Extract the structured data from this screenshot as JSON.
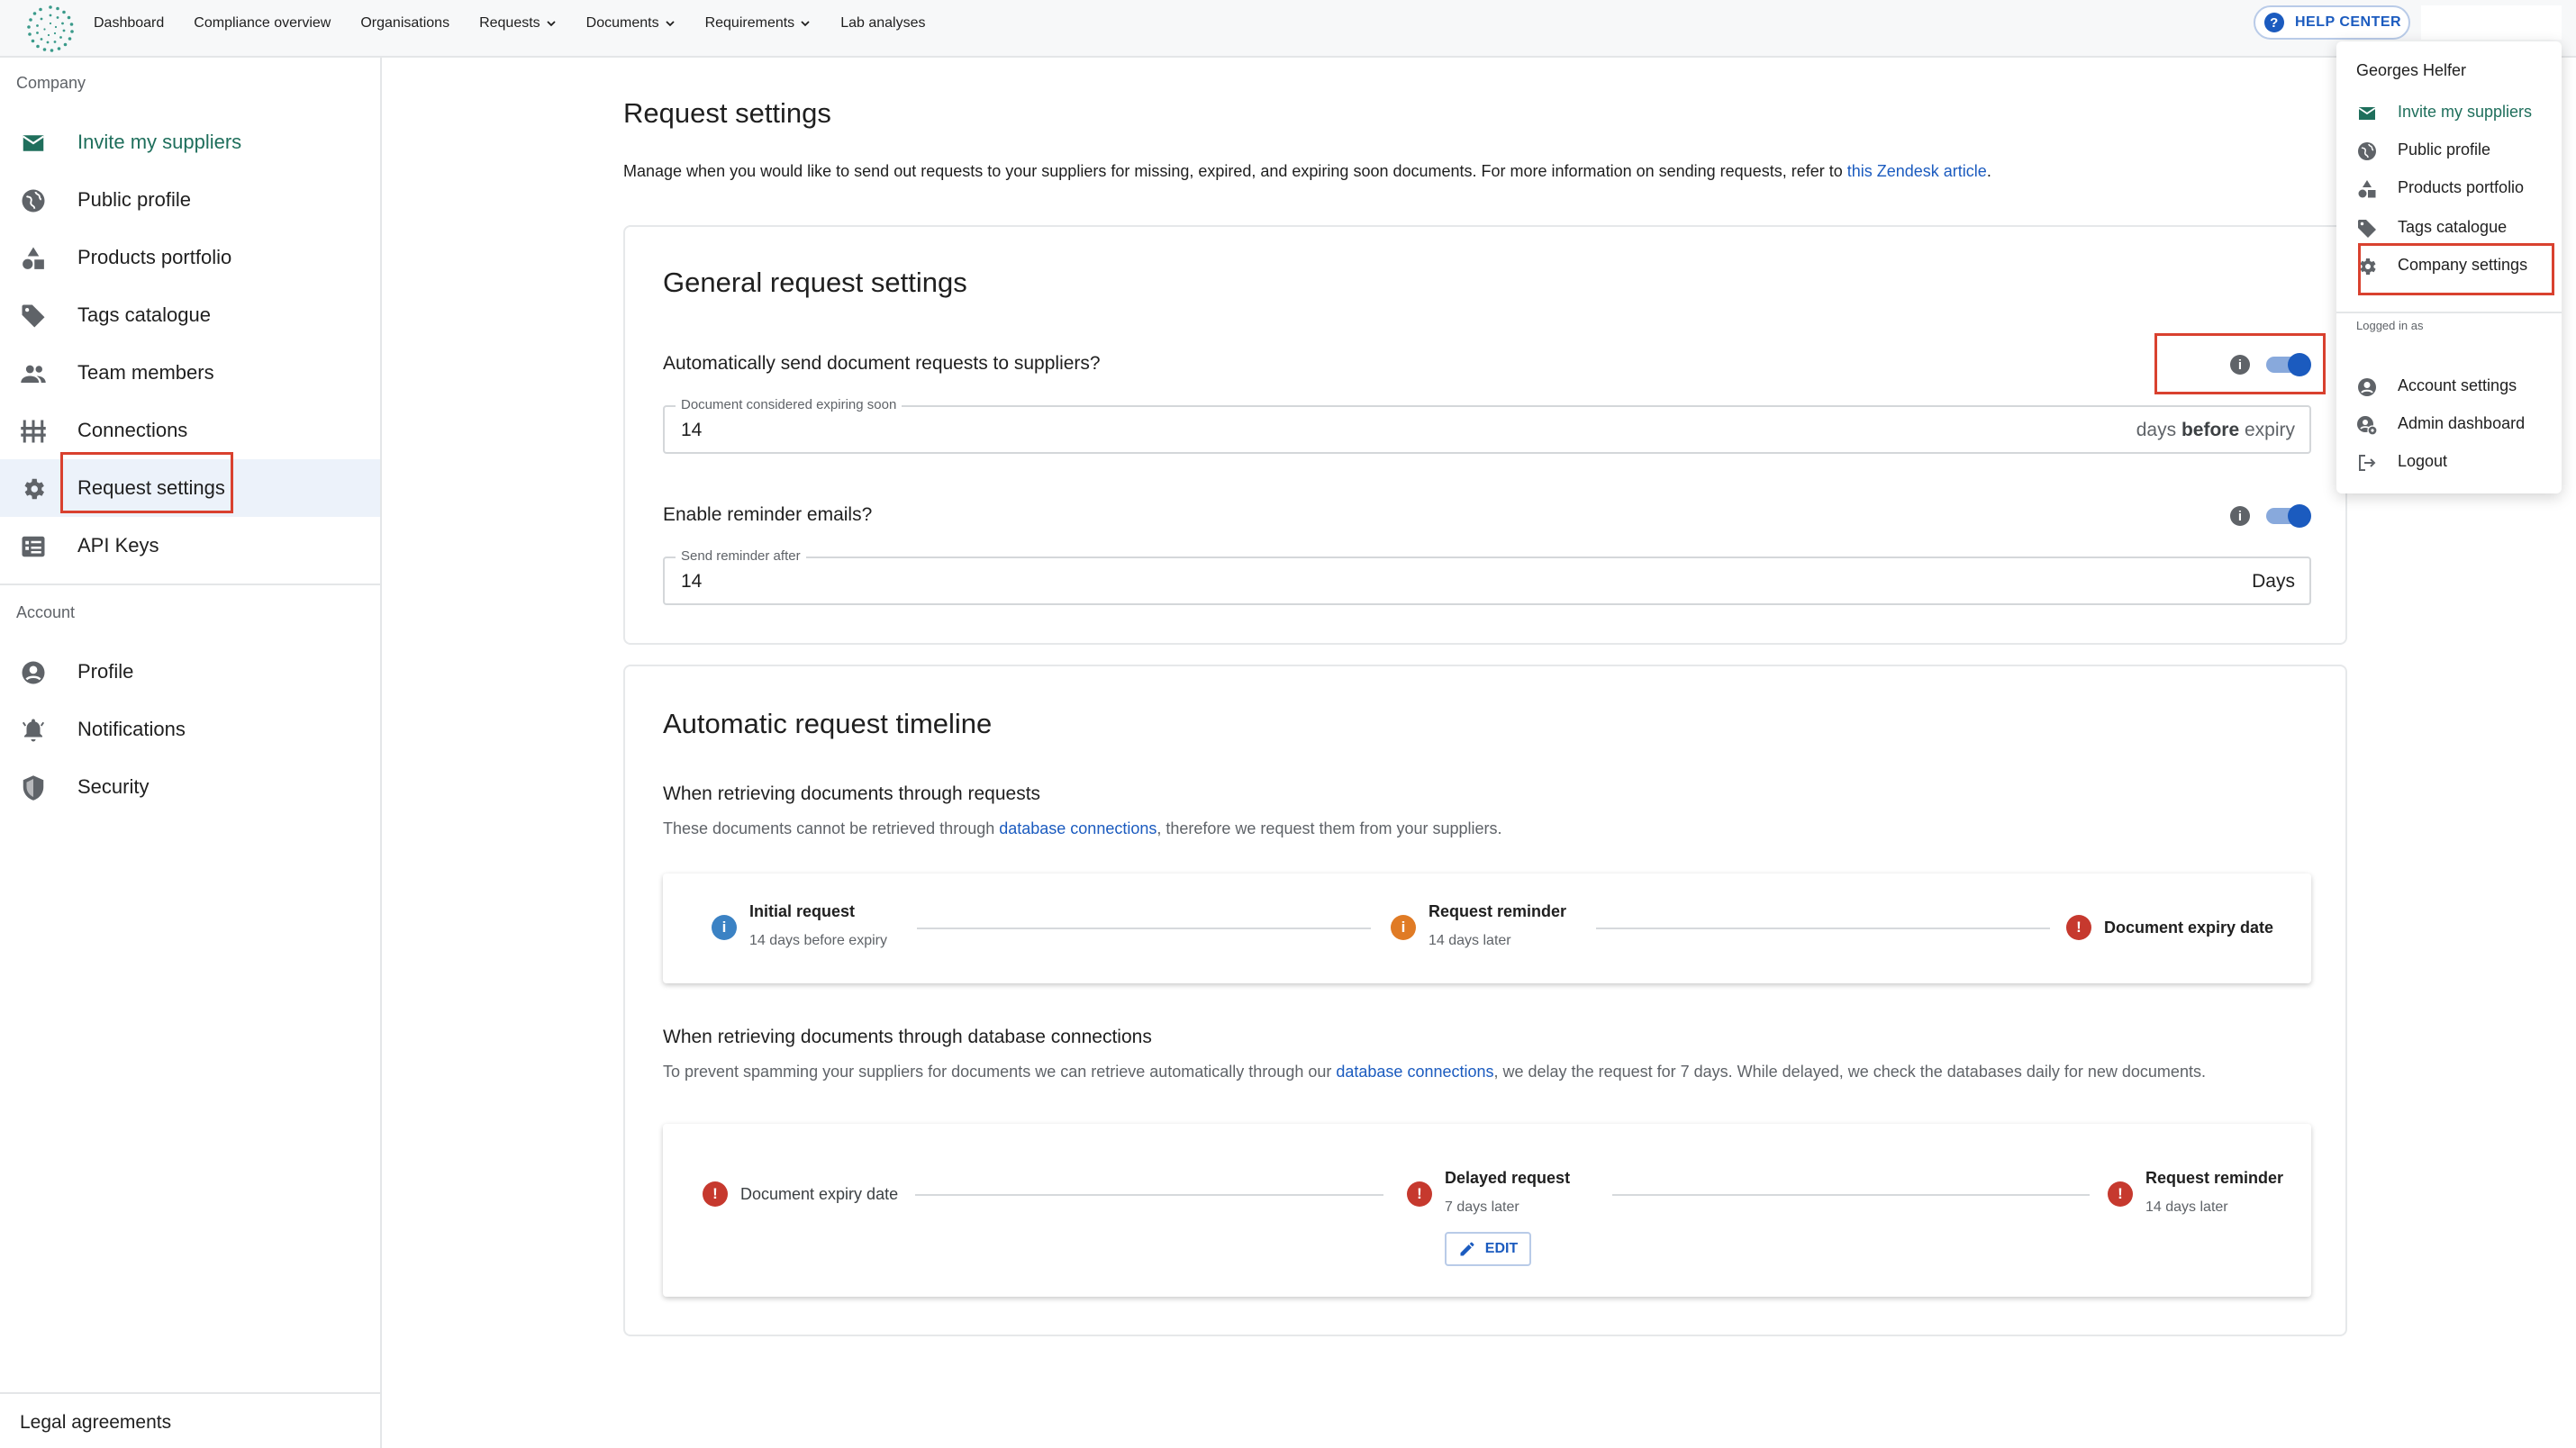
{
  "nav": {
    "items": [
      {
        "label": "Dashboard",
        "dropdown": false
      },
      {
        "label": "Compliance overview",
        "dropdown": false
      },
      {
        "label": "Organisations",
        "dropdown": false
      },
      {
        "label": "Requests",
        "dropdown": true
      },
      {
        "label": "Documents",
        "dropdown": true
      },
      {
        "label": "Requirements",
        "dropdown": true
      },
      {
        "label": "Lab analyses",
        "dropdown": false
      }
    ],
    "help_label": "HELP CENTER"
  },
  "sidebar": {
    "company_title": "Company",
    "company_items": [
      {
        "label": "Invite my suppliers",
        "icon": "mail-icon"
      },
      {
        "label": "Public profile",
        "icon": "globe-icon"
      },
      {
        "label": "Products portfolio",
        "icon": "shapes-icon"
      },
      {
        "label": "Tags catalogue",
        "icon": "tag-icon"
      },
      {
        "label": "Team members",
        "icon": "people-icon"
      },
      {
        "label": "Connections",
        "icon": "connections-icon"
      },
      {
        "label": "Request settings",
        "icon": "gear-icon"
      },
      {
        "label": "API Keys",
        "icon": "api-keys-icon"
      }
    ],
    "account_title": "Account",
    "account_items": [
      {
        "label": "Profile",
        "icon": "user-circle-icon"
      },
      {
        "label": "Notifications",
        "icon": "bell-icon"
      },
      {
        "label": "Security",
        "icon": "shield-icon"
      }
    ],
    "legal": "Legal agreements"
  },
  "main": {
    "title": "Request settings",
    "intro_text": "Manage when you would like to send out requests to your suppliers for missing, expired, and expiring soon documents. For more information on sending requests, refer to ",
    "intro_link": "this Zendesk article",
    "intro_end": "."
  },
  "general": {
    "title": "General request settings",
    "auto_send_label": "Automatically send document requests to suppliers?",
    "auto_send_on": true,
    "expiring_field": {
      "label": "Document considered expiring soon",
      "value": "14",
      "suffix_a": "days ",
      "suffix_b": "before",
      "suffix_c": " expiry"
    },
    "reminder_label": "Enable reminder emails?",
    "reminder_on": true,
    "reminder_field": {
      "label": "Send reminder after",
      "value": "14",
      "suffix": "Days"
    }
  },
  "timeline": {
    "title": "Automatic request timeline",
    "requests": {
      "title": "When retrieving documents through requests",
      "desc_a": "These documents cannot be retrieved through ",
      "desc_link": "database connections",
      "desc_b": ", therefore we request them from your suppliers.",
      "steps": [
        {
          "title": "Initial request",
          "sub": "14 days before expiry"
        },
        {
          "title": "Request reminder",
          "sub": "14 days later"
        },
        {
          "title": "Document expiry date",
          "sub": ""
        }
      ]
    },
    "db": {
      "title": "When retrieving documents through database connections",
      "desc_a": "To prevent spamming your suppliers for documents we can retrieve automatically through our ",
      "desc_link": "database connections",
      "desc_b": ", we delay the request for 7 days. While delayed, we check the databases daily for new documents.",
      "steps": [
        {
          "title": "Document expiry date",
          "sub": ""
        },
        {
          "title": "Delayed request",
          "sub": "7 days later"
        },
        {
          "title": "Request reminder",
          "sub": "14 days later"
        }
      ],
      "edit_label": "EDIT"
    }
  },
  "dropdown": {
    "user_name": "Georges Helfer",
    "items": [
      {
        "label": "Invite my suppliers",
        "icon": "mail-icon"
      },
      {
        "label": "Public profile",
        "icon": "globe-icon"
      },
      {
        "label": "Products portfolio",
        "icon": "shapes-icon"
      },
      {
        "label": "Tags catalogue",
        "icon": "tag-icon"
      },
      {
        "label": "Company settings",
        "icon": "gear-icon"
      }
    ],
    "logged_in_as": "Logged in as",
    "account_items": [
      {
        "label": "Account settings",
        "icon": "user-circle-icon"
      },
      {
        "label": "Admin dashboard",
        "icon": "admin-icon"
      },
      {
        "label": "Logout",
        "icon": "logout-icon"
      }
    ]
  },
  "colors": {
    "accent": "#1b5bbf",
    "highlight_green": "#1f6f5c",
    "annotation_red": "#d9412f"
  }
}
